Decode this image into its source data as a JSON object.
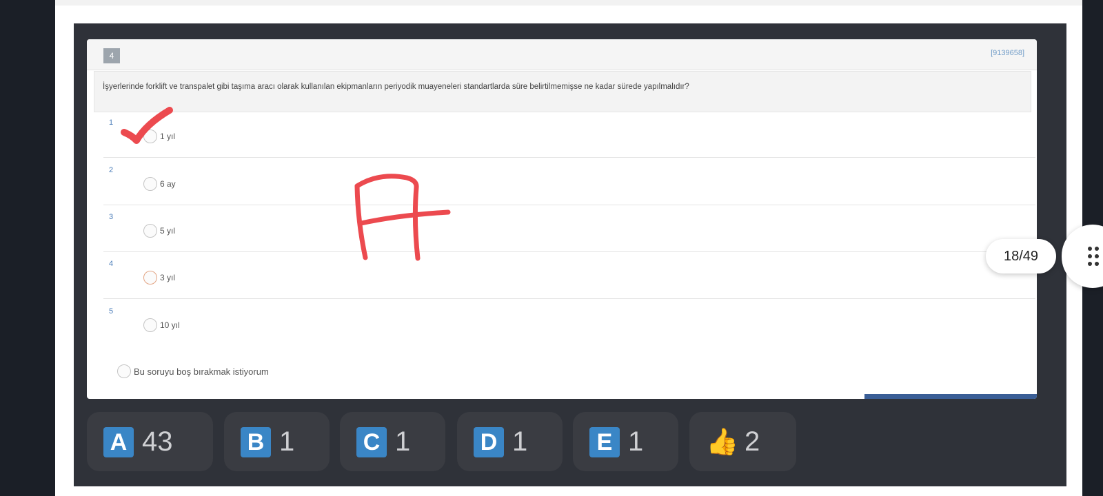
{
  "question": {
    "number": "4",
    "id": "[9139658]",
    "text": "İşyerlerinde forklift ve transpalet gibi taşıma aracı olarak kullanılan ekipmanların periyodik muayeneleri standartlarda süre belirtilmemişse ne kadar sürede yapılmalıdır?",
    "options": [
      {
        "num": "1",
        "label": "1 yıl"
      },
      {
        "num": "2",
        "label": "6 ay"
      },
      {
        "num": "3",
        "label": "5 yıl"
      },
      {
        "num": "4",
        "label": "3 yıl"
      },
      {
        "num": "5",
        "label": "10 yıl"
      }
    ],
    "skip_label": "Bu soruyu boş bırakmak istiyorum"
  },
  "annotations": {
    "checkmark_on_option": "1",
    "handwritten_letter": "A",
    "color": "#ec4a4f"
  },
  "votes": [
    {
      "letter": "A",
      "count": "43"
    },
    {
      "letter": "B",
      "count": "1"
    },
    {
      "letter": "C",
      "count": "1"
    },
    {
      "letter": "D",
      "count": "1"
    },
    {
      "letter": "E",
      "count": "1"
    },
    {
      "icon": "thumbs-up-icon",
      "glyph": "👍",
      "count": "2"
    }
  ],
  "page_counter": "18/49",
  "menu_icon": "drag-dots-icon"
}
